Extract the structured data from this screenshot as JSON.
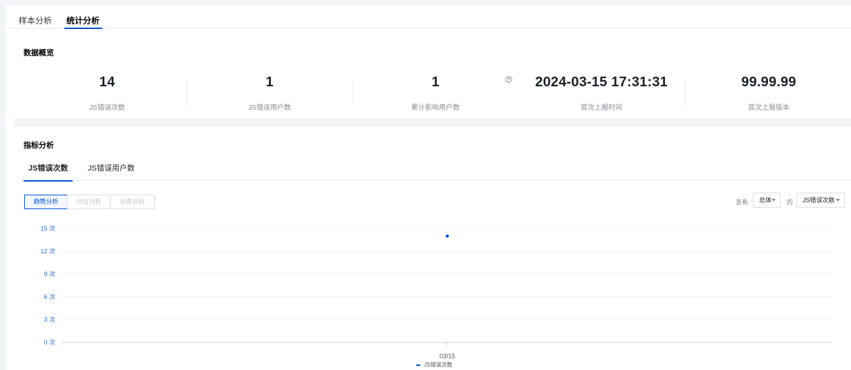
{
  "tabs": [
    "样本分析",
    "统计分析"
  ],
  "overview": {
    "title": "数据概览",
    "stats": [
      {
        "value": "14",
        "label": "JS错误次数"
      },
      {
        "value": "1",
        "label": "JS错误用户数"
      },
      {
        "value": "1",
        "label": "累计影响用户数"
      },
      {
        "value": "2024-03-15 17:31:31",
        "label": "首次上报时间"
      },
      {
        "value": "99.99.99",
        "label": "首次上报版本"
      }
    ]
  },
  "metrics": {
    "title": "指标分析",
    "tabs": [
      "JS错误次数",
      "JS错误用户数"
    ],
    "analysis_buttons": [
      "趋势分析",
      "分位分析",
      "分布分析"
    ],
    "view_prefix": "查看",
    "view_scope": "总体",
    "view_of": "的",
    "view_metric": "JS错误次数"
  },
  "colors": {
    "accent": "#0052d9",
    "tick_label": "#2f6fd6"
  },
  "chart_data": {
    "type": "scatter",
    "categories": [
      "03/15"
    ],
    "series": [
      {
        "name": "JS错误次数",
        "values": [
          14
        ]
      }
    ],
    "ylim": [
      0,
      15
    ],
    "yticks": [
      0,
      3,
      6,
      9,
      12,
      15
    ],
    "ytick_labels": [
      "0 次",
      "3 次",
      "6 次",
      "9 次",
      "12 次",
      "15 次"
    ],
    "grid": true,
    "legend": "bottom"
  }
}
